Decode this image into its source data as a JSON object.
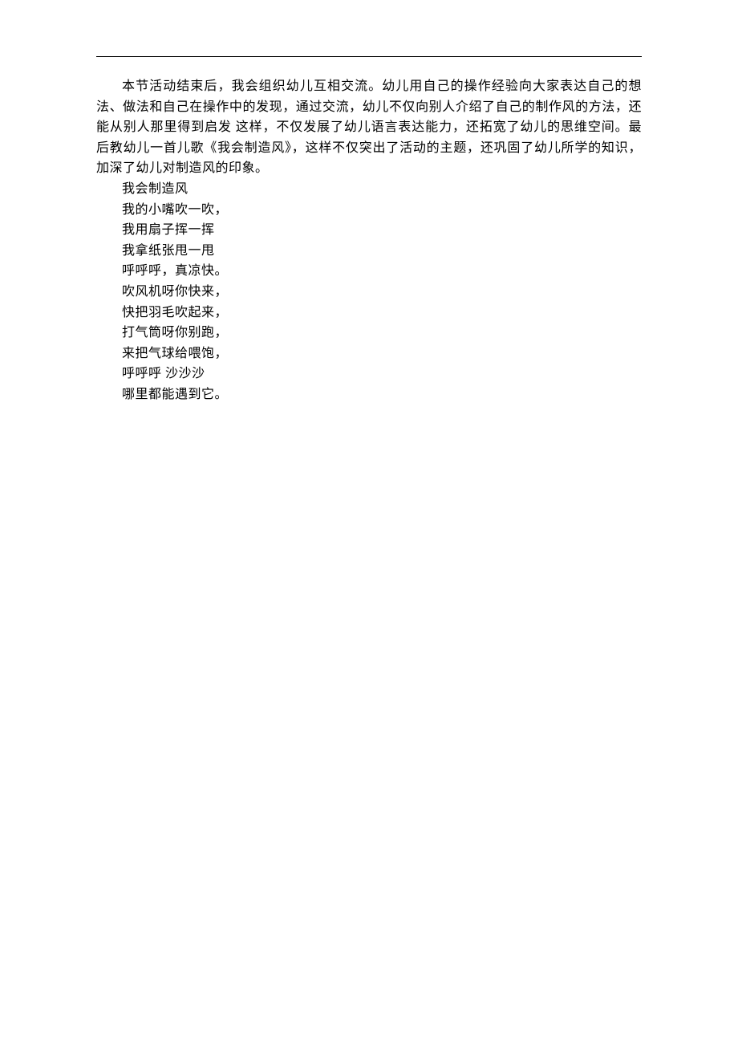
{
  "paragraph": "本节活动结束后，我会组织幼儿互相交流。幼儿用自己的操作经验向大家表达自己的想法、做法和自己在操作中的发现，通过交流，幼儿不仅向别人介绍了自己的制作风的方法，还能从别人那里得到启发 这样，不仅发展了幼儿语言表达能力，还拓宽了幼儿的思维空间。最后教幼儿一首儿歌《我会制造风》，这样不仅突出了活动的主题，还巩固了幼儿所学的知识，加深了幼儿对制造风的印象。",
  "poem": {
    "lines": [
      "我会制造风",
      "我的小嘴吹一吹，",
      "我用扇子挥一挥",
      "我拿纸张甩一甩",
      "呼呼呼，真凉快。",
      "吹风机呀你快来，",
      "快把羽毛吹起来，",
      "打气筒呀你别跑，",
      "来把气球给喂饱，",
      "呼呼呼 沙沙沙",
      "哪里都能遇到它。"
    ]
  }
}
